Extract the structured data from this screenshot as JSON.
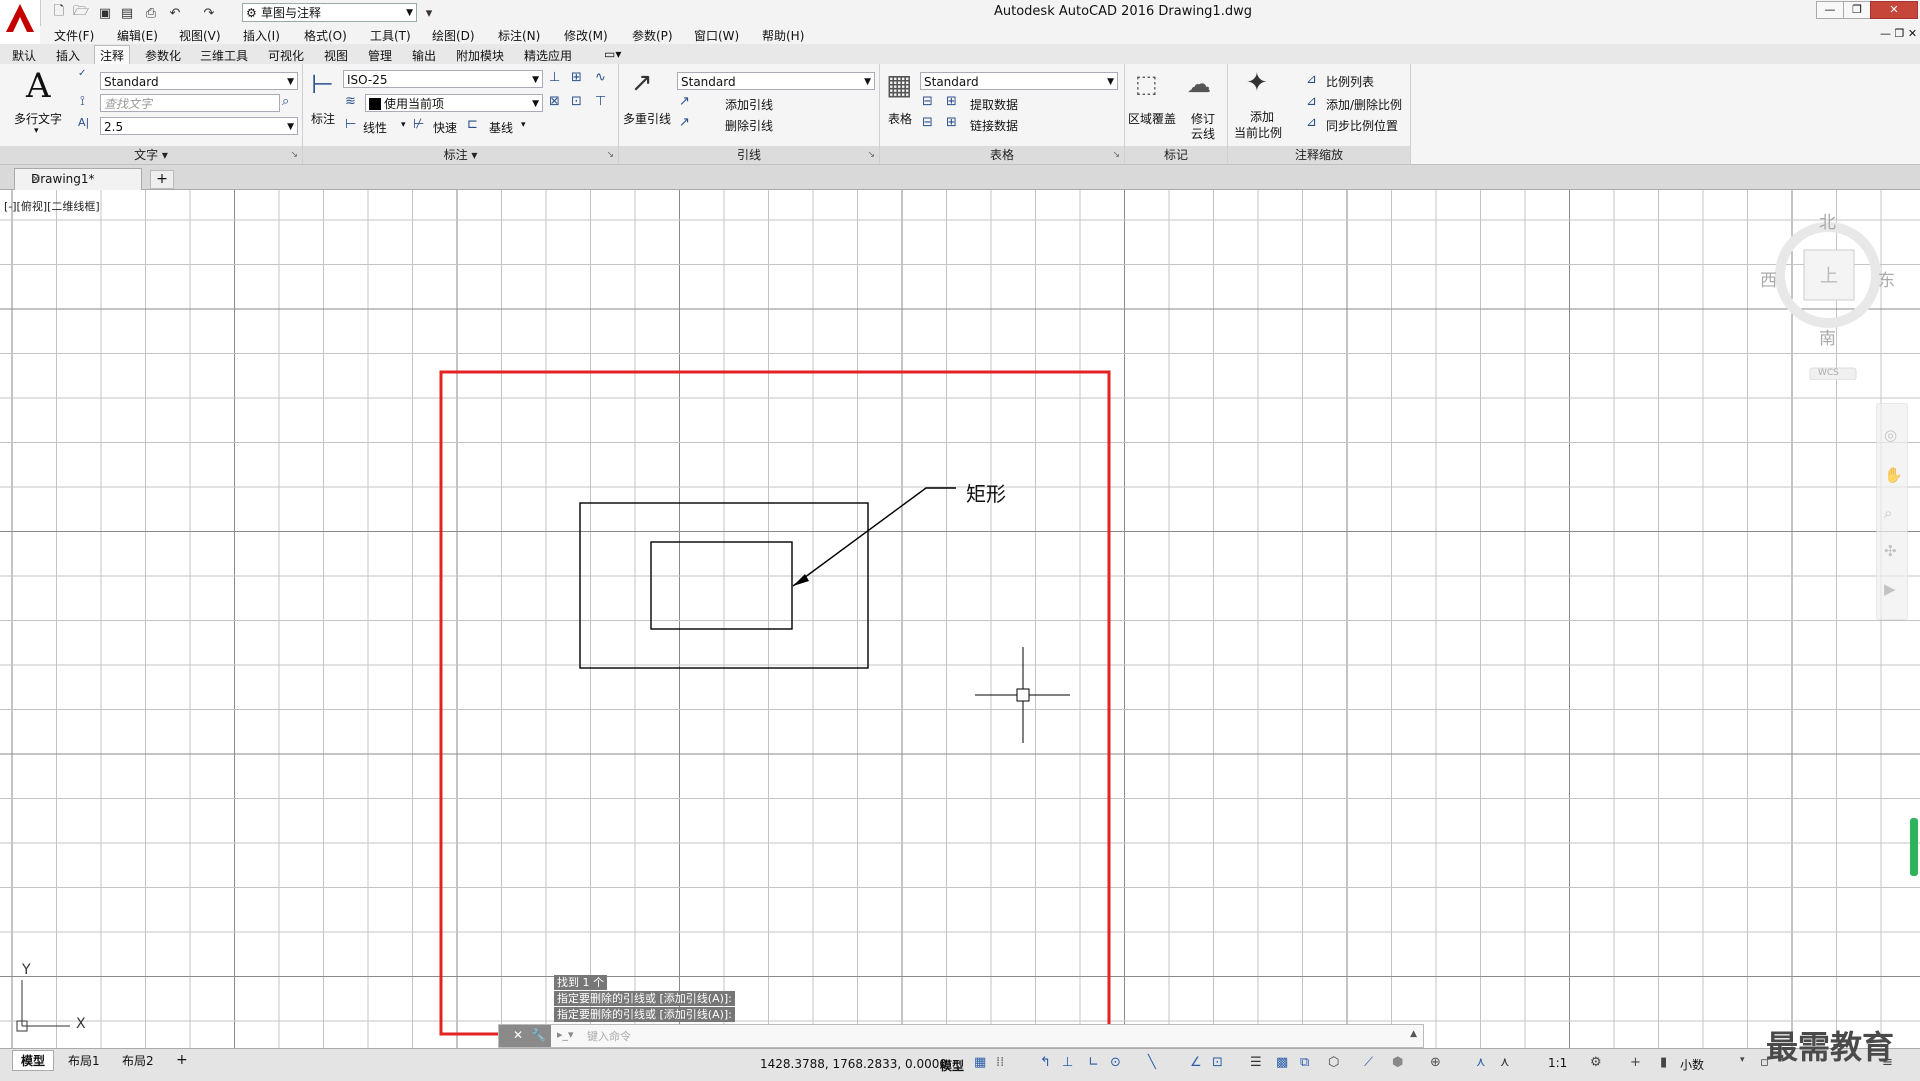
{
  "window": {
    "title": "Autodesk AutoCAD 2016    Drawing1.dwg",
    "workspace": "草图与注释"
  },
  "menu": [
    "文件(F)",
    "编辑(E)",
    "视图(V)",
    "插入(I)",
    "格式(O)",
    "工具(T)",
    "绘图(D)",
    "标注(N)",
    "修改(M)",
    "参数(P)",
    "窗口(W)",
    "帮助(H)"
  ],
  "ribbon_tabs": [
    "默认",
    "插入",
    "注释",
    "参数化",
    "三维工具",
    "可视化",
    "视图",
    "管理",
    "输出",
    "附加模块",
    "精选应用"
  ],
  "ribbon": {
    "text": {
      "multiline_label": "多行文字",
      "style_value": "Standard",
      "find_placeholder": "查找文字",
      "height_value": "2.5",
      "panel_title": "文字"
    },
    "dimension": {
      "dim_label": "标注",
      "style_value": "ISO-25",
      "layer_value": "使用当前项",
      "linear": "线性",
      "quick": "快速",
      "baseline": "基线",
      "panel_title": "标注"
    },
    "leader": {
      "multileader_label": "多重引线",
      "style_value": "Standard",
      "add_leader": "添加引线",
      "remove_leader": "删除引线",
      "panel_title": "引线"
    },
    "table": {
      "table_label": "表格",
      "style_value": "Standard",
      "extract_data": "提取数据",
      "link_data": "链接数据",
      "panel_title": "表格"
    },
    "markup": {
      "wipeout_label": "区域覆盖",
      "revcloud_label_1": "修订",
      "revcloud_label_2": "云线",
      "panel_title": "标记"
    },
    "annoscale": {
      "add_label_1": "添加",
      "add_label_2": "当前比例",
      "scale_list": "比例列表",
      "add_delete_scale": "添加/删除比例",
      "sync_scale": "同步比例位置",
      "panel_title": "注释缩放"
    }
  },
  "doc_tabs": {
    "active": "Drawing1*"
  },
  "viewport_label": "[-][俯视][二维线框]",
  "drawing": {
    "leader_text": "矩形"
  },
  "viewcube": {
    "north": "北",
    "south": "南",
    "east": "东",
    "west": "西",
    "top_face": "上",
    "wcs": "WCS"
  },
  "ucs": {
    "x": "X",
    "y": "Y"
  },
  "command": {
    "history": [
      "找到 1 个",
      "指定要删除的引线或 [添加引线(A)]:",
      "指定要删除的引线或 [添加引线(A)]:"
    ],
    "placeholder": "键入命令"
  },
  "layout_tabs": [
    "模型",
    "布局1",
    "布局2"
  ],
  "status": {
    "coords": "1428.3788, 1768.2833, 0.0000",
    "model": "模型",
    "scale": "1:1",
    "units": "小数"
  },
  "watermark": "最需教育",
  "colors": {
    "selection": "#e32222",
    "accent": "#c40000",
    "grid": "#bfbfbf"
  }
}
